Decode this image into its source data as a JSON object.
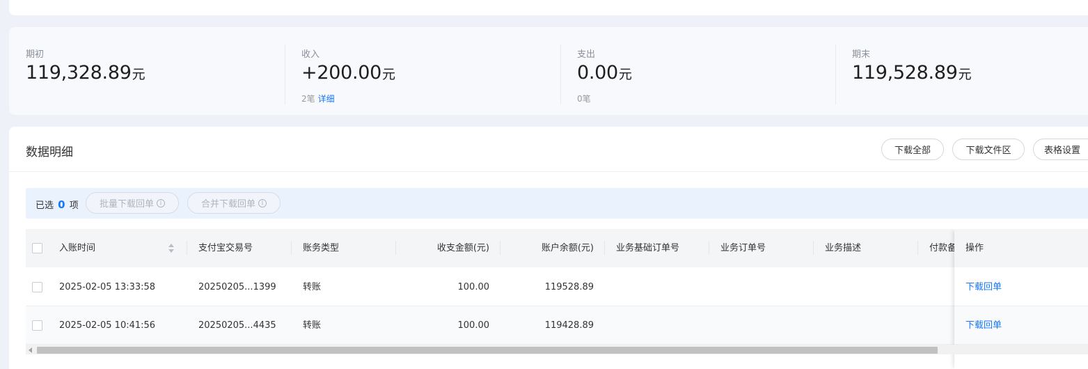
{
  "summary": {
    "opening": {
      "label": "期初",
      "value": "119,328.89",
      "unit": "元"
    },
    "income": {
      "label": "收入",
      "value": "+200.00",
      "unit": "元",
      "count": "2笔",
      "detail_link": "详细"
    },
    "expense": {
      "label": "支出",
      "value": "0.00",
      "unit": "元",
      "count": "0笔"
    },
    "closing": {
      "label": "期末",
      "value": "119,528.89",
      "unit": "元"
    }
  },
  "detail": {
    "title": "数据明细",
    "buttons": {
      "download_all": "下载全部",
      "download_files": "下载文件区",
      "table_settings": "表格设置"
    }
  },
  "selection": {
    "prefix": "已选",
    "count": "0",
    "suffix": "项",
    "batch_download": "批量下载回单",
    "merge_download": "合并下载回单",
    "info_glyph": "i"
  },
  "table": {
    "headers": {
      "time": "入账时间",
      "trade_no": "支付宝交易号",
      "type": "账务类型",
      "amount": "收支金额(元)",
      "balance": "账户余额(元)",
      "base_order": "业务基础订单号",
      "order": "业务订单号",
      "desc": "业务描述",
      "payer": "付款备",
      "action": "操作"
    },
    "rows": [
      {
        "time": "2025-02-05 13:33:58",
        "trade_no": "20250205...1399",
        "type": "转账",
        "amount": "100.00",
        "balance": "119528.89",
        "action": "下载回单"
      },
      {
        "time": "2025-02-05 10:41:56",
        "trade_no": "20250205...4435",
        "type": "转账",
        "amount": "100.00",
        "balance": "119428.89",
        "action": "下载回单"
      }
    ]
  },
  "icons": [
    "info-icon",
    "sort-icon",
    "checkbox",
    "scroll-left-arrow-icon",
    "scroll-right-arrow-icon"
  ],
  "colors": {
    "accent": "#1677ff",
    "page_bg": "#eef2f8"
  },
  "scroll": {
    "horizontal_position_fraction": 0.0
  }
}
